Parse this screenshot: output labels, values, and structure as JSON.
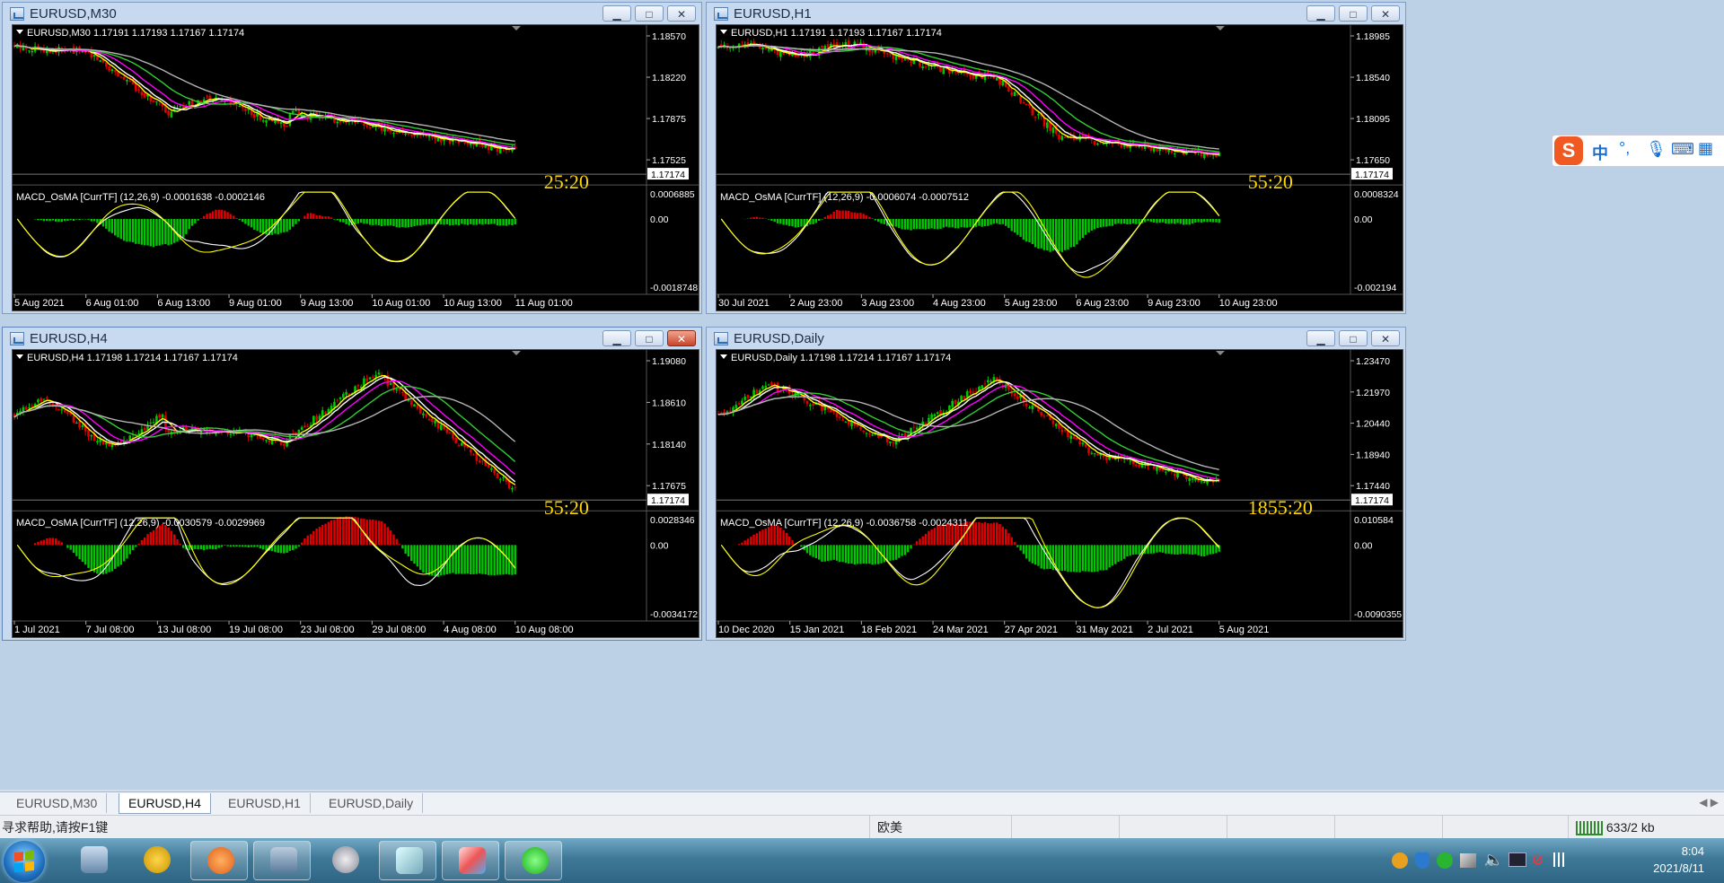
{
  "windows": [
    {
      "id": "m30",
      "title": "EURUSD,M30",
      "info": "EURUSD,M30  1.17191 1.17193 1.17167 1.17174",
      "ticks": [
        "1.18570",
        "1.18220",
        "1.17875",
        "1.17525",
        "1.17174"
      ],
      "price_label": "1.17174",
      "macd_label": "MACD_OsMA [CurrTF] (12,26,9) -0.0001638 -0.0002146",
      "macd_ticks": [
        "0.0006885",
        "0.00",
        "-0.0018748"
      ],
      "dates": [
        "5 Aug 2021",
        "6 Aug 01:00",
        "6 Aug 13:00",
        "9 Aug 01:00",
        "9 Aug 13:00",
        "10 Aug 01:00",
        "10 Aug 13:00",
        "11 Aug 01:00"
      ],
      "timer": "25:20"
    },
    {
      "id": "h1",
      "title": "EURUSD,H1",
      "info": "EURUSD,H1  1.17191 1.17193 1.17167 1.17174",
      "ticks": [
        "1.18985",
        "1.18540",
        "1.18095",
        "1.17650",
        "1.17174"
      ],
      "price_label": "1.17174",
      "macd_label": "MACD_OsMA [CurrTF] (12,26,9) -0.0006074 -0.0007512",
      "macd_ticks": [
        "0.0008324",
        "0.00",
        "-0.002194"
      ],
      "dates": [
        "30 Jul 2021",
        "2 Aug 23:00",
        "3 Aug 23:00",
        "4 Aug 23:00",
        "5 Aug 23:00",
        "6 Aug 23:00",
        "9 Aug 23:00",
        "10 Aug 23:00"
      ],
      "timer": "55:20"
    },
    {
      "id": "h4",
      "title": "EURUSD,H4",
      "info": "EURUSD,H4  1.17198 1.17214 1.17167 1.17174",
      "ticks": [
        "1.19080",
        "1.18610",
        "1.18140",
        "1.17675",
        "1.17174"
      ],
      "price_label": "1.17174",
      "macd_label": "MACD_OsMA [CurrTF] (12,26,9) -0.0030579 -0.0029969",
      "macd_ticks": [
        "0.0028346",
        "0.00",
        "-0.0034172"
      ],
      "dates": [
        "1 Jul 2021",
        "7 Jul 08:00",
        "13 Jul 08:00",
        "19 Jul 08:00",
        "23 Jul 08:00",
        "29 Jul 08:00",
        "4 Aug 08:00",
        "10 Aug 08:00"
      ],
      "timer": "55:20"
    },
    {
      "id": "d1",
      "title": "EURUSD,Daily",
      "info": "EURUSD,Daily  1.17198 1.17214 1.17167 1.17174",
      "ticks": [
        "1.23470",
        "1.21970",
        "1.20440",
        "1.18940",
        "1.17440",
        "1.17174"
      ],
      "price_label": "1.17174",
      "macd_label": "MACD_OsMA [CurrTF] (12,26,9) -0.0036758 -0.0024311",
      "macd_ticks": [
        "0.010584",
        "0.00",
        "-0.0090355"
      ],
      "dates": [
        "10 Dec 2020",
        "15 Jan 2021",
        "18 Feb 2021",
        "24 Mar 2021",
        "27 Apr 2021",
        "31 May 2021",
        "2 Jul 2021",
        "5 Aug 2021"
      ],
      "timer": "1855:20"
    }
  ],
  "tabs": [
    "EURUSD,M30",
    "EURUSD,H4",
    "EURUSD,H1",
    "EURUSD,Daily"
  ],
  "active_tab": "EURUSD,H4",
  "status": {
    "help": "寻求帮助,请按F1键",
    "profile": "欧美",
    "traffic": "633/2 kb"
  },
  "clock": {
    "time": "8:04",
    "date": "2021/8/11"
  },
  "ime": {
    "lang": "中"
  },
  "colors": {
    "bull": "#00c800",
    "bear": "#e00000",
    "ma_fast": "#ffff00",
    "ma_white": "#ffffff",
    "ma_magenta": "#ff00ff",
    "ma_green": "#32cd32",
    "ma_gray": "#b4b4b4"
  }
}
